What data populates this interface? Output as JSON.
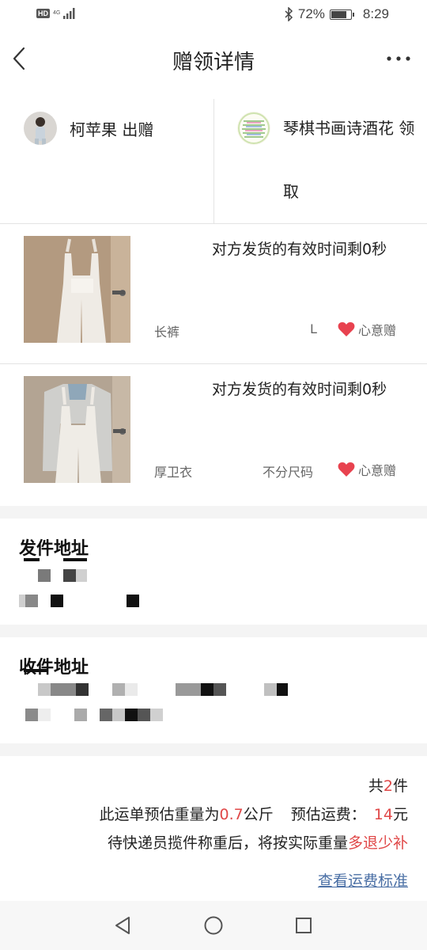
{
  "status_bar": {
    "network_badge": "HD",
    "network_type": "4G",
    "battery_percent": "72%",
    "time": "8:29"
  },
  "header": {
    "title": "赠领详情"
  },
  "parties": {
    "giver_label": "柯苹果 出赠",
    "receiver_label": "琴棋书画诗酒花 领取"
  },
  "items": [
    {
      "timer_text": "对方发货的有效时间剩0秒",
      "category": "长裤",
      "size": "L",
      "gift_label": "心意赠"
    },
    {
      "timer_text": "对方发货的有效时间剩0秒",
      "category": "厚卫衣",
      "size": "不分尺码",
      "gift_label": "心意赠"
    }
  ],
  "sender_address": {
    "title": "发件地址"
  },
  "receiver_address": {
    "title": "收件地址"
  },
  "summary": {
    "count_prefix": "共",
    "count": "2",
    "count_suffix": "件",
    "weight_prefix": "此运单预估重量为",
    "weight": "0.7",
    "weight_unit": "公斤",
    "fee_label": "预估运费：",
    "fee": "14",
    "fee_unit": "元",
    "note_prefix": "待快递员揽件称重后，将按实际重量",
    "note_highlight": "多退少补",
    "link_text": "查看运费标准"
  },
  "colors": {
    "accent_red": "#e04848",
    "link_blue": "#4a6fa5",
    "heart": "#e8424f"
  }
}
